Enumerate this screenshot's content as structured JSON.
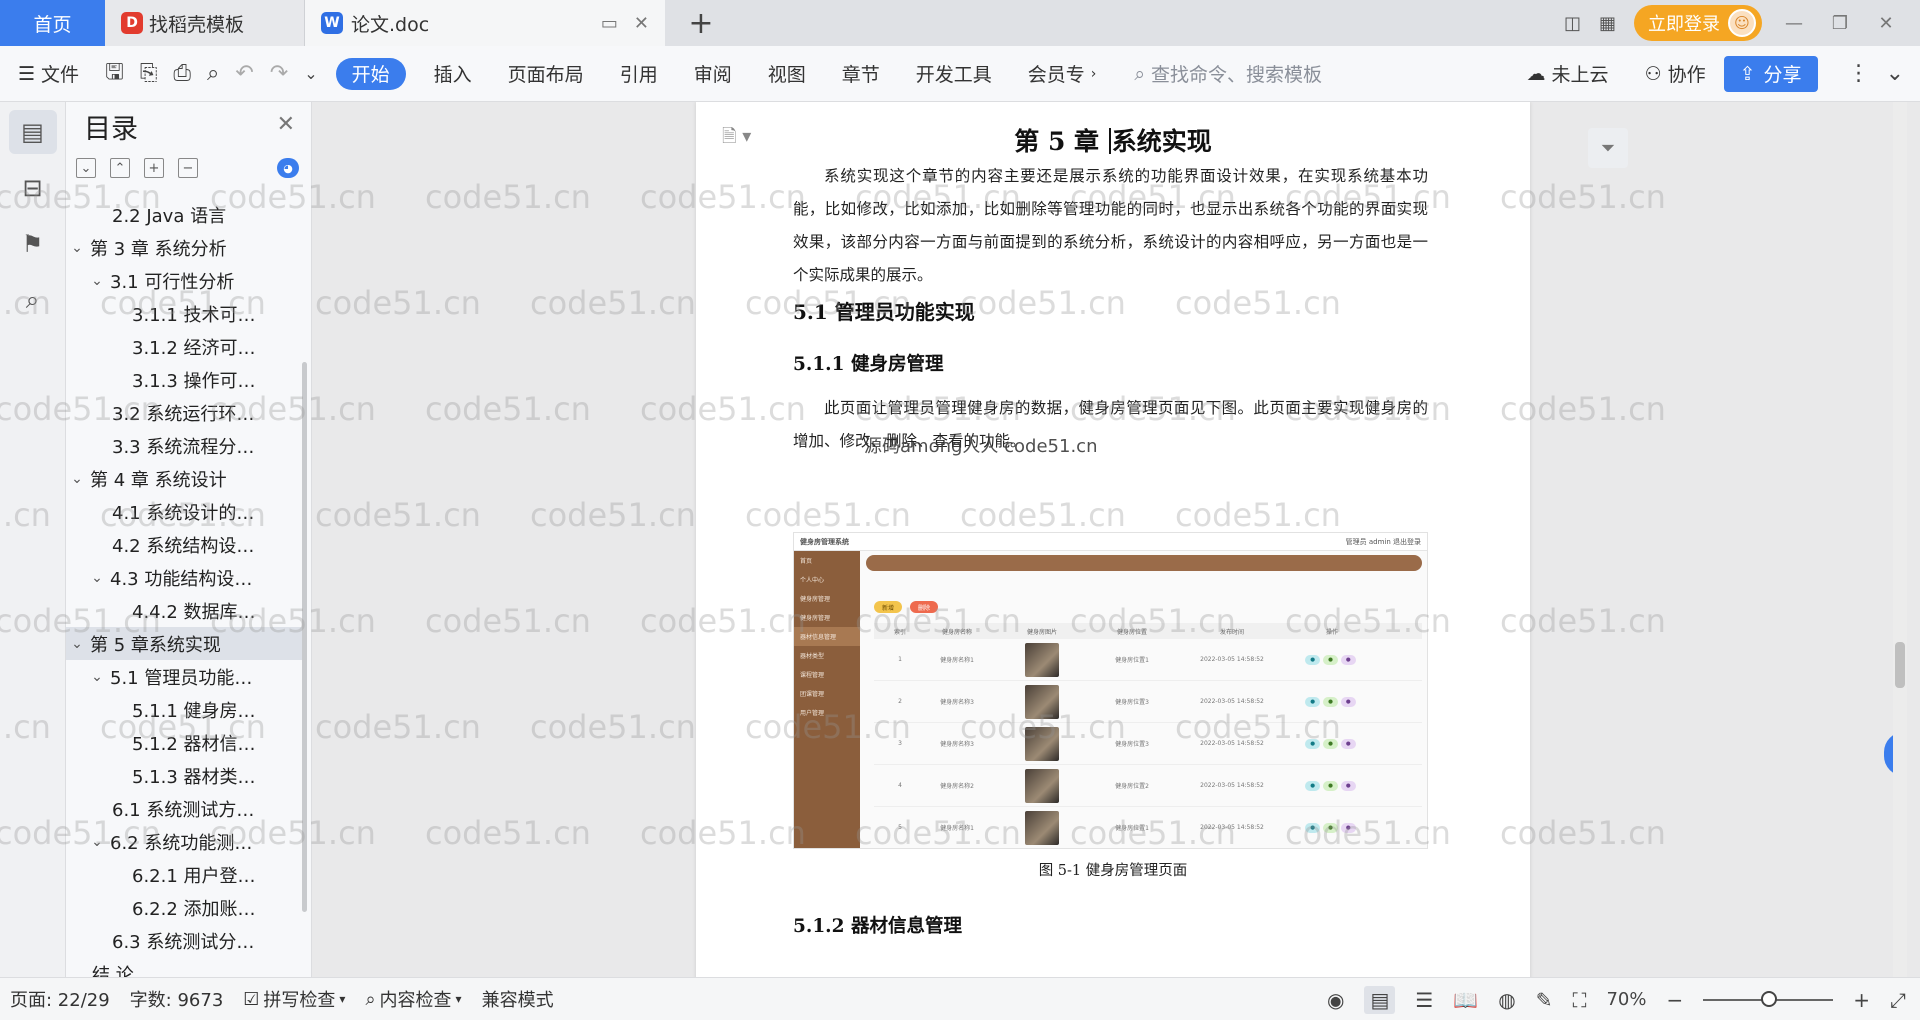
{
  "tabs": {
    "home": "首页",
    "template": "找稻壳模板",
    "document": "论文.doc"
  },
  "titlebar": {
    "login": "立即登录"
  },
  "ribbon": {
    "file": "文件",
    "menus": [
      "开始",
      "插入",
      "页面布局",
      "引用",
      "审阅",
      "视图",
      "章节",
      "开发工具",
      "会员专"
    ],
    "search_placeholder": "查找命令、搜索模板",
    "cloud": "未上云",
    "collab": "协作",
    "share": "分享"
  },
  "toc": {
    "title": "目录",
    "items": [
      {
        "label": "2.2 Java 语言",
        "level": 2,
        "caret": ""
      },
      {
        "label": "第 3 章  系统分析",
        "level": 1,
        "caret": "v"
      },
      {
        "label": "3.1 可行性分析",
        "level": 2,
        "caret": "v"
      },
      {
        "label": "3.1.1 技术可…",
        "level": 3,
        "caret": ""
      },
      {
        "label": "3.1.2 经济可…",
        "level": 3,
        "caret": ""
      },
      {
        "label": "3.1.3 操作可…",
        "level": 3,
        "caret": ""
      },
      {
        "label": "3.2 系统运行环…",
        "level": 2,
        "caret": ""
      },
      {
        "label": "3.3 系统流程分…",
        "level": 2,
        "caret": ""
      },
      {
        "label": "第 4 章  系统设计",
        "level": 1,
        "caret": "v"
      },
      {
        "label": "4.1  系统设计的…",
        "level": 2,
        "caret": ""
      },
      {
        "label": "4.2  系统结构设…",
        "level": 2,
        "caret": ""
      },
      {
        "label": "4.3 功能结构设…",
        "level": 2,
        "caret": "v"
      },
      {
        "label": "4.4.2  数据库…",
        "level": 3,
        "caret": ""
      },
      {
        "label": "第 5 章系统实现",
        "level": 1,
        "caret": "v",
        "selected": true
      },
      {
        "label": "5.1 管理员功能…",
        "level": 2,
        "caret": "v"
      },
      {
        "label": "5.1.1  健身房…",
        "level": 3,
        "caret": ""
      },
      {
        "label": "5.1.2  器材信…",
        "level": 3,
        "caret": ""
      },
      {
        "label": "5.1.3 器材类…",
        "level": 3,
        "caret": ""
      },
      {
        "label": "6.1 系统测试方…",
        "level": 2,
        "caret": ""
      },
      {
        "label": "6.2  系统功能测…",
        "level": 2,
        "caret": "v"
      },
      {
        "label": "6.2.1  用户登…",
        "level": 3,
        "caret": ""
      },
      {
        "label": "6.2.2  添加账…",
        "level": 3,
        "caret": ""
      },
      {
        "label": "6.3  系统测试分…",
        "level": 2,
        "caret": ""
      },
      {
        "label": "结    论",
        "level": 1,
        "caret": ""
      }
    ]
  },
  "document": {
    "chapter_num": "第 5 章 ",
    "chapter_title": "系统实现",
    "intro": "系统实现这个章节的内容主要还是展示系统的功能界面设计效果，在实现系统基本功能，比如修改，比如添加，比如删除等管理功能的同时，也显示出系统各个功能的界面实现效果，该部分内容一方面与前面提到的系统分析，系统设计的内容相呼应，另一方面也是一个实际成果的展示。",
    "h2": "5.1 管理员功能实现",
    "h3a": "5.1.1  健身房管理",
    "para2": "此页面让管理员管理健身房的数据，健身房管理页面见下图。此页面主要实现健身房的增加、修改、删除、查看的功能。",
    "caption": "图 5-1  健身房管理页面",
    "h3b": "5.1.2  器材信息管理",
    "overlay": "源码among人人 code51.cn"
  },
  "screenshot": {
    "app_title": "健身房管理系统",
    "user": "管理员 admin  退出登录",
    "menu": [
      "首页",
      "个人中心",
      "健身房管理",
      "健身房管理",
      "器材信息管理",
      "器材类型",
      "课程管理",
      "团课管理",
      "用户管理"
    ],
    "columns": [
      "索引",
      "健身房名称",
      "健身房图片",
      "健身房位置",
      "发布时间",
      "操作"
    ],
    "rows": [
      [
        "1",
        "健身房名称1",
        "健身房位置1",
        "2022-03-05 14:58:52"
      ],
      [
        "2",
        "健身房名称3",
        "健身房位置3",
        "2022-03-05 14:58:52"
      ],
      [
        "3",
        "健身房名称3",
        "健身房位置3",
        "2022-03-05 14:58:52"
      ],
      [
        "4",
        "健身房名称2",
        "健身房位置2",
        "2022-03-05 14:58:52"
      ],
      [
        "5",
        "健身房名称1",
        "健身房位置1",
        "2022-03-05 14:58:52"
      ]
    ],
    "btn_add": "新增",
    "btn_del": "删除"
  },
  "statusbar": {
    "page": "页面: 22/29",
    "words": "字数: 9673",
    "spell": "拼写检查",
    "content": "内容检查",
    "compat": "兼容模式",
    "zoom": "70%"
  },
  "watermark": "code51.cn",
  "colors": {
    "accent": "#3b7ded",
    "login": "#f5a623",
    "shot_sidebar": "#8b5e3c"
  }
}
